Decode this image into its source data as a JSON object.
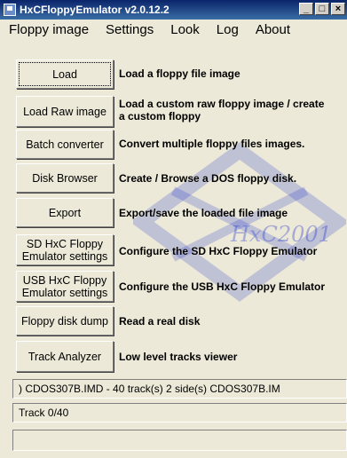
{
  "window": {
    "title": "HxCFloppyEmulator v2.0.12.2",
    "controls": [
      "_",
      "□",
      "×"
    ]
  },
  "menu": [
    {
      "label": "Floppy image"
    },
    {
      "label": "Settings"
    },
    {
      "label": "Look"
    },
    {
      "label": "Log"
    },
    {
      "label": "About"
    }
  ],
  "watermark": {
    "text": "HxC2001"
  },
  "actions": [
    {
      "button": "Load",
      "description": "Load a floppy file image"
    },
    {
      "button": "Load Raw image",
      "description": "Load a custom raw floppy image / create a custom floppy"
    },
    {
      "button": "Batch converter",
      "description": "Convert multiple floppy files images."
    },
    {
      "button": "Disk Browser",
      "description": "Create / Browse a DOS floppy disk."
    },
    {
      "button": "Export",
      "description": "Export/save the loaded file image"
    },
    {
      "button": "SD HxC Floppy Emulator settings",
      "description": "Configure the SD HxC Floppy Emulator"
    },
    {
      "button": "USB HxC Floppy Emulator settings",
      "description": "Configure the USB HxC Floppy Emulator"
    },
    {
      "button": "Floppy disk dump",
      "description": "Read a real disk"
    },
    {
      "button": "Track Analyzer",
      "description": "Low level tracks viewer"
    }
  ],
  "status": {
    "file_line": ")    CDOS307B.IMD - 40 track(s) 2 side(s)     CDOS307B.IM",
    "track_line": "Track 0/40",
    "empty_line": ""
  },
  "colors": {
    "watermark": "#2233cc",
    "face": "#ece9d8",
    "titlebar": "#0a246a"
  }
}
